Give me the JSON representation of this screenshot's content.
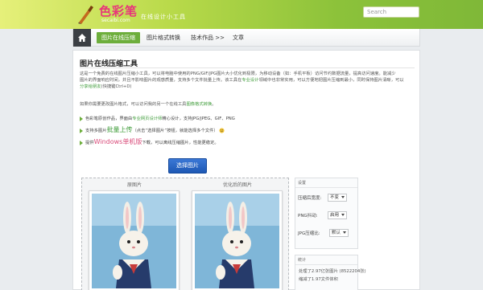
{
  "header": {
    "logo_name": "色彩笔",
    "logo_domain": "secaibi.com",
    "tagline": "在线设计小工具",
    "search_placeholder": "Search"
  },
  "nav": {
    "items": [
      "图片在线压缩",
      "图片格式转换",
      "技术作品 >>",
      "文章"
    ]
  },
  "main": {
    "title": "图片在线压缩工具",
    "intro_1": "这是一个免费的在线图片压缩小工具，可以将电脑中使用的PNG/GIF/JPG图片大小优化到极限，为移动设备（如：手机平板）访问节约数据流量，提高访问速度。能减少",
    "intro_2": "图片的界面响应时间，并且不影响图片的观感质量，支持多个文件批量上传。该工具在",
    "intro_2b": "专业设计",
    "intro_2c": "领域中也非常实用，可以方便地把图片压缩到最小，同时保持图片清晰，可以",
    "intro_3": "分享给朋友",
    "intro_3b": "(快捷键Ctrl+D)",
    "convert_1": "如果你需要更改图片格式，可以访问我的另一个在线工具",
    "convert_link": "图像格式转换",
    "convert_2": "。",
    "feature_1a": "色彩笔原创作品，界面由",
    "feature_1b": "专业网页设计师",
    "feature_1c": "精心设计，支持JPG/JPEG、GIF、PNG",
    "feature_2a": "支持多图片",
    "feature_2b": "批量上传",
    "feature_2c": "（点击“选择图片”按钮，就能选择多个文件）",
    "feature_3a": "提供",
    "feature_3b": "Windows单机版",
    "feature_3c": "下载，可以离线压缩图片，性能更稳定。",
    "select_button": "选择图片"
  },
  "compare": {
    "original_label": "原图片",
    "optimized_label": "优化后的图片"
  },
  "settings": {
    "title": "设置",
    "rows": [
      {
        "label": "压缩后宽度:",
        "value": "不变"
      },
      {
        "label": "PNG抖动:",
        "value": "启用"
      },
      {
        "label": "JPG压缩比:",
        "value": "默认"
      }
    ]
  },
  "stats": {
    "title": "统计",
    "line_1": "处理了2.97亿张图片 (8522204张)",
    "line_2": "缩减了1.97文件体积"
  },
  "colors": {
    "accent_green": "#6dae3c",
    "button_blue": "#1d58b4",
    "logo_pink": "#e8357a"
  }
}
